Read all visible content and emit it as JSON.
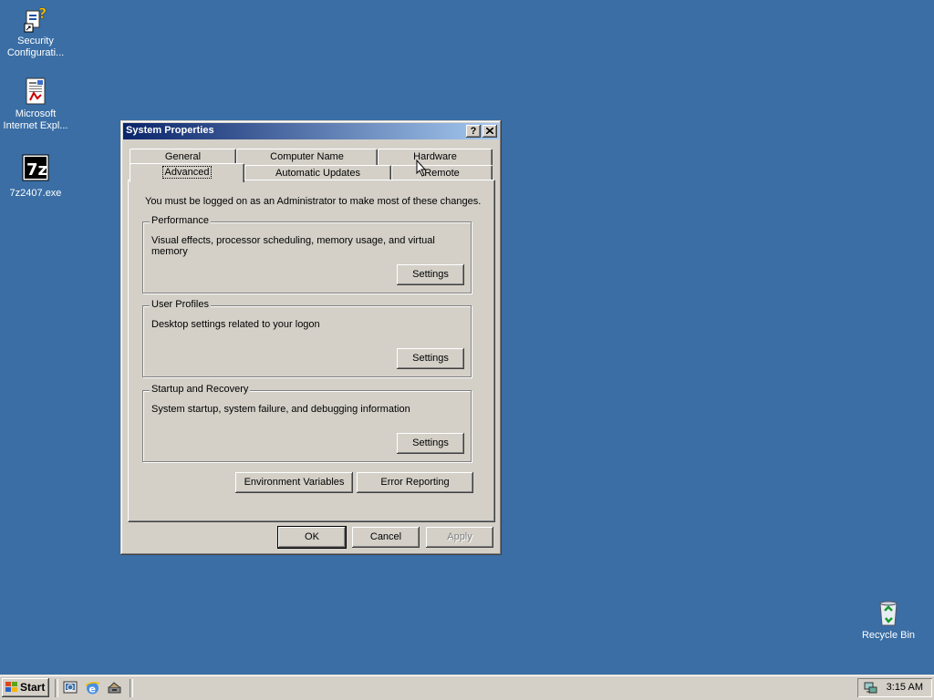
{
  "desktop": {
    "icons": [
      {
        "label": "Security Configurati...",
        "icon": "security-config-shortcut-icon"
      },
      {
        "label": "Microsoft Internet Expl...",
        "icon": "ie-document-icon"
      },
      {
        "label": "7z2407.exe",
        "icon": "7zip-icon"
      },
      {
        "label": "Recycle Bin",
        "icon": "recycle-bin-icon"
      }
    ],
    "background_color": "#3A6EA5"
  },
  "window": {
    "title": "System Properties",
    "help_button": "?",
    "close_button": "✕",
    "tabs_row1": [
      "General",
      "Computer Name",
      "Hardware"
    ],
    "tabs_row2": [
      "Advanced",
      "Automatic Updates",
      "Remote"
    ],
    "selected_tab": "Advanced",
    "notice": "You must be logged on as an Administrator to make most of these changes.",
    "groups": [
      {
        "title": "Performance",
        "description": "Visual effects, processor scheduling, memory usage, and virtual memory",
        "button": "Settings"
      },
      {
        "title": "User Profiles",
        "description": "Desktop settings related to your logon",
        "button": "Settings"
      },
      {
        "title": "Startup and Recovery",
        "description": "System startup, system failure, and debugging information",
        "button": "Settings"
      }
    ],
    "env_vars_button": "Environment Variables",
    "error_reporting_button": "Error Reporting",
    "ok_button": "OK",
    "cancel_button": "Cancel",
    "apply_button": "Apply"
  },
  "taskbar": {
    "start_label": "Start",
    "quick_launch": [
      "show-desktop-icon",
      "internet-explorer-icon",
      "network-icon"
    ],
    "clock": "3:15 AM"
  }
}
